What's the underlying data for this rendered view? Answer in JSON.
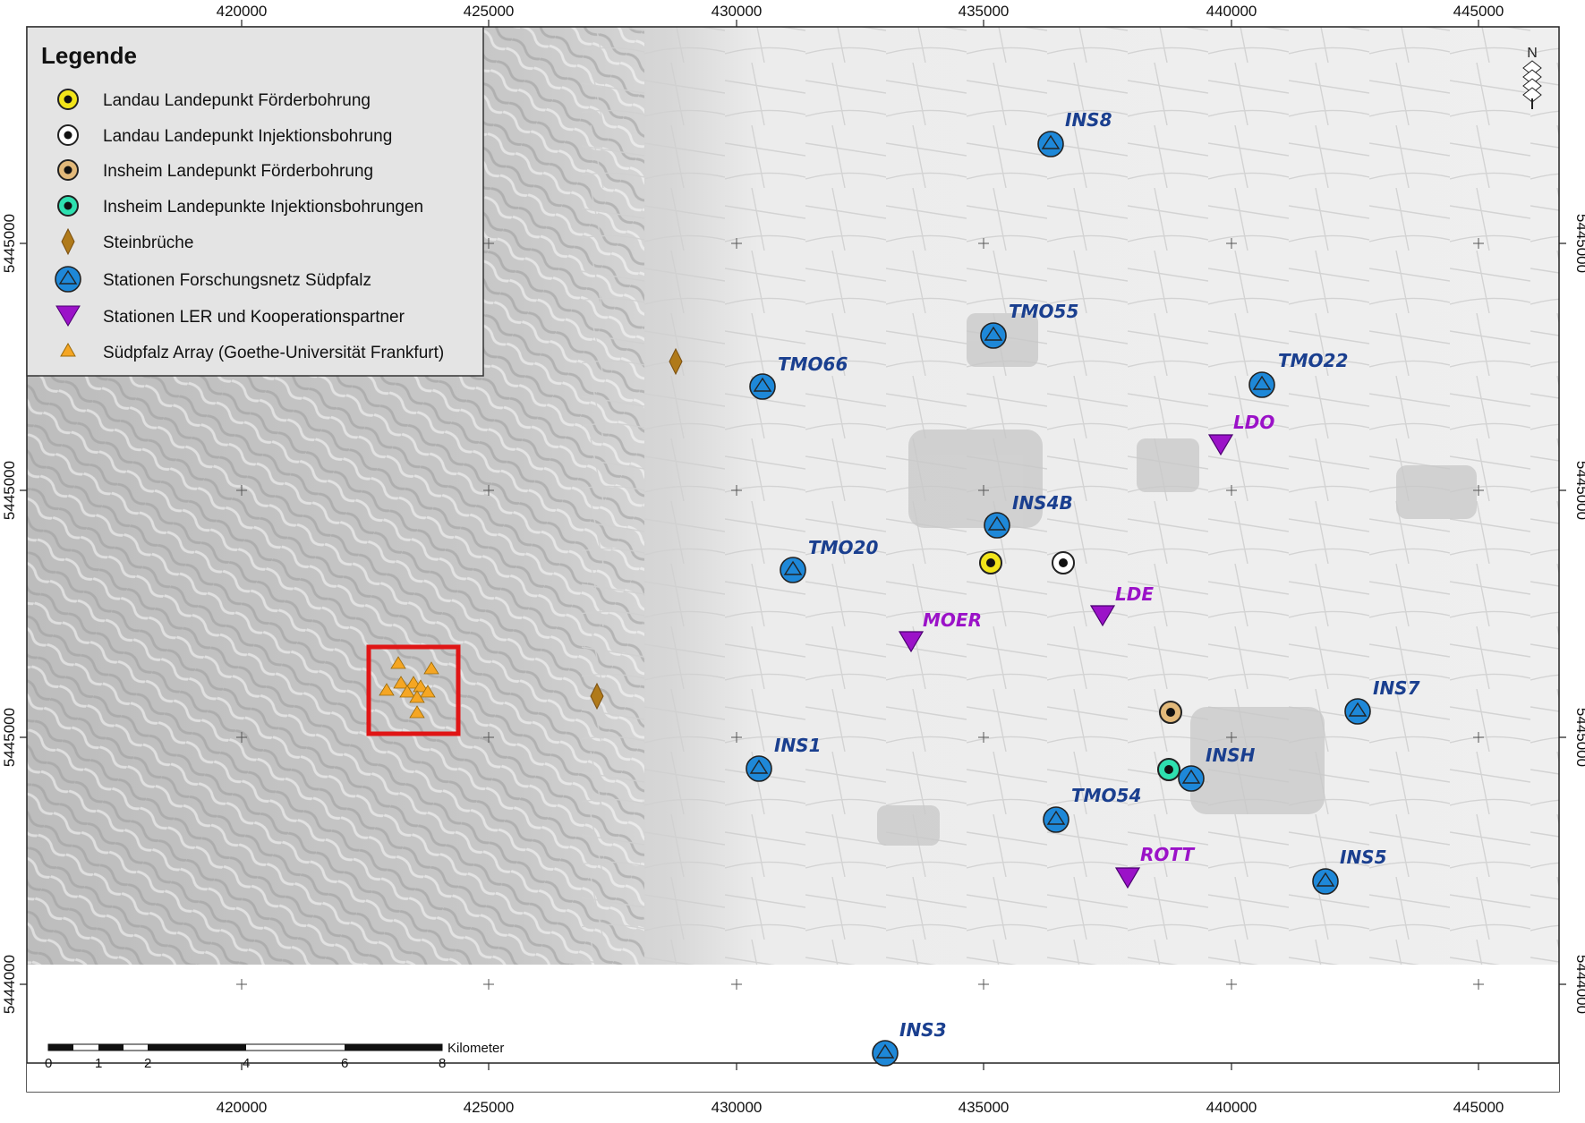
{
  "axes": {
    "x_ticks": [
      "420000",
      "425000",
      "430000",
      "435000",
      "440000",
      "445000"
    ],
    "y_ticks": [
      "5445000",
      "5445000",
      "5445000",
      "5444000"
    ]
  },
  "legend": {
    "title": "Legende",
    "items": [
      {
        "label": "Landau Landepunkt Förderbohrung",
        "symbol": "circle-yellow-icon"
      },
      {
        "label": "Landau Landepunkt Injektionsbohrung",
        "symbol": "circle-white-icon"
      },
      {
        "label": "Insheim Landepunkt Förderbohrung",
        "symbol": "circle-tan-icon"
      },
      {
        "label": "Insheim Landepunkte Injektionsbohrungen",
        "symbol": "circle-teal-icon"
      },
      {
        "label": "Steinbrüche",
        "symbol": "diamond-brown-icon"
      },
      {
        "label": "Stationen Forschungsnetz Südpfalz",
        "symbol": "blue-circle-triangle-icon"
      },
      {
        "label": "Stationen LER und Kooperationspartner",
        "symbol": "purple-down-triangle-icon"
      },
      {
        "label": "Südpfalz Array (Goethe-Universität Frankfurt)",
        "symbol": "orange-triangle-icon"
      }
    ]
  },
  "stations_fs": [
    "INS8",
    "TMO55",
    "TMO66",
    "TMO22",
    "INS4B",
    "TMO20",
    "INS7",
    "INS1",
    "INSH",
    "TMO54",
    "INS5",
    "INS3"
  ],
  "stations_ler": [
    "LDO",
    "LDE",
    "MOER",
    "ROTT"
  ],
  "scalebar": {
    "ticks": [
      "0",
      "1",
      "2",
      "4",
      "6",
      "8"
    ],
    "unit": "Kilometer"
  },
  "colors": {
    "blue_station": "#1e88d8",
    "blue_label": "#1a3f8f",
    "purple": "#9b12c8",
    "yellow": "#f2e51a",
    "tan": "#e2b97a",
    "teal": "#2ee0b0",
    "brown": "#b07a1a",
    "orange": "#f5a623",
    "red_box": "#e01515"
  }
}
